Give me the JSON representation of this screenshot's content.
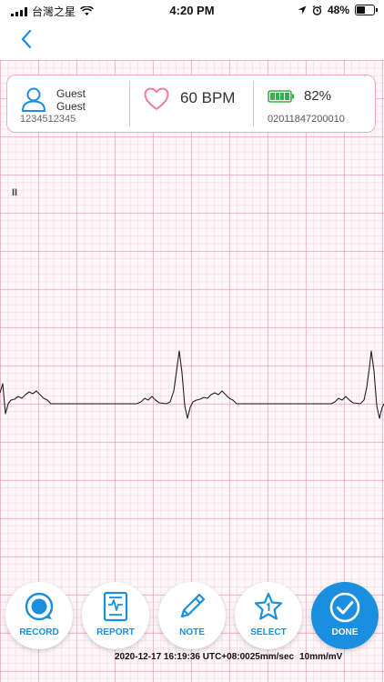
{
  "status_bar": {
    "carrier": "台灣之星",
    "time": "4:20 PM",
    "battery_percent": "48%",
    "icons": [
      "signal-icon",
      "wifi-icon",
      "location-icon",
      "alarm-icon",
      "battery-icon"
    ]
  },
  "nav": {
    "back_icon": "chevron-left-icon"
  },
  "info": {
    "user_name_line1": "Guest",
    "user_name_line2": "Guest",
    "user_id": "1234512345",
    "heart_rate": "60 BPM",
    "device_battery": "82%",
    "device_battery_level": 1.0,
    "device_id": "02011847200010"
  },
  "ecg": {
    "pause_indicator": "II"
  },
  "buttons": {
    "record": "RECORD",
    "report": "REPORT",
    "note": "NOTE",
    "select": "SELECT",
    "done": "DONE"
  },
  "footer": {
    "timestamp": "2020-12-17 16:19:36 UTC+08:00",
    "speed": "25mm/sec",
    "gain": "10mm/mV"
  },
  "colors": {
    "accent": "#1a8fe0",
    "grid_major": "#ee96b4",
    "grid_minor": "#f5c8d7",
    "heart": "#f37aa6",
    "battery": "#33b14a"
  }
}
